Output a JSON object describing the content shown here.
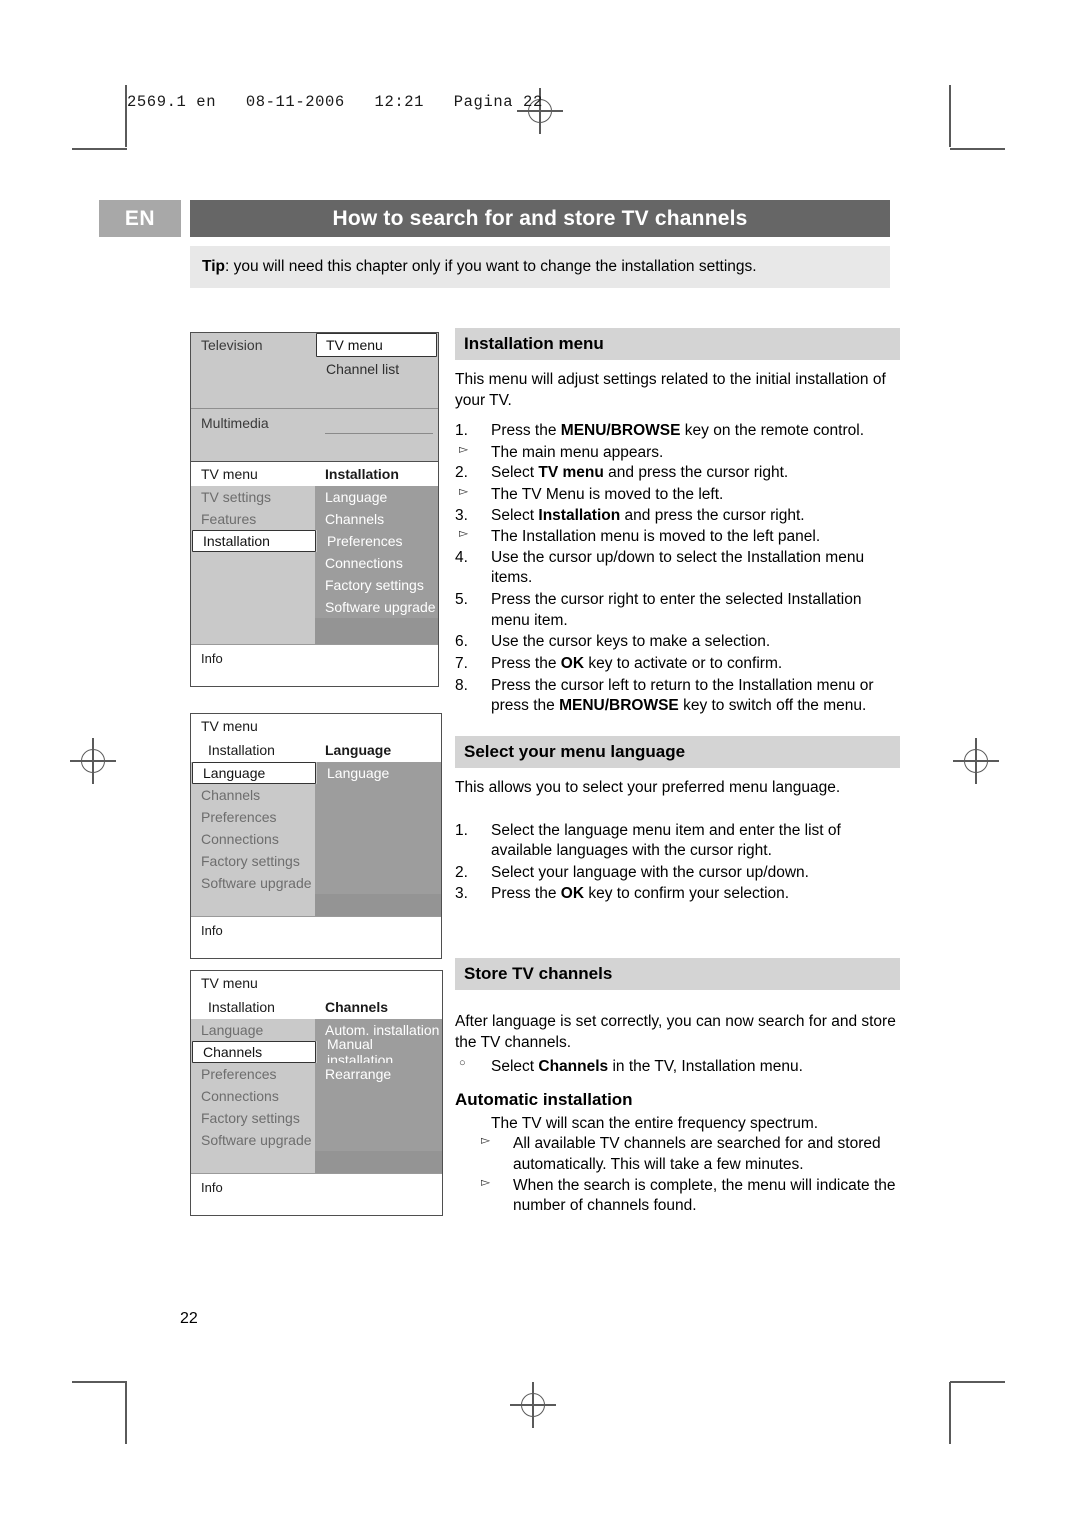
{
  "slug": "2569.1 en   08-11-2006   12:21   Pagina 22",
  "header": {
    "language_tab": "EN",
    "title": "How to search for and store TV channels",
    "tip_label": "Tip",
    "tip_text": ": you will need this chapter only if you want to change the installation settings."
  },
  "page_number": "22",
  "sections": [
    {
      "heading": "Installation menu",
      "intro": "This menu will adjust settings related to the initial installation of your TV.",
      "steps": [
        {
          "num": "1.",
          "text_pre": "Press the ",
          "kw": "MENU/BROWSE",
          "text_post": " key on the remote control.",
          "sub": "The main menu appears."
        },
        {
          "num": "2.",
          "text_pre": "Select ",
          "kw": "TV menu",
          "text_post": " and press the cursor right.",
          "sub": "The TV Menu is moved to the left."
        },
        {
          "num": "3.",
          "text_pre": "Select ",
          "kw": "Installation",
          "text_post": " and press the cursor right.",
          "sub": "The Installation menu is moved to the left panel."
        },
        {
          "num": "4.",
          "text_pre": "Use the cursor up/down to select the Installation menu items.",
          "kw": "",
          "text_post": "",
          "sub": ""
        },
        {
          "num": "5.",
          "text_pre": "Press the cursor right to enter the selected Installation menu item.",
          "kw": "",
          "text_post": "",
          "sub": ""
        },
        {
          "num": "6.",
          "text_pre": "Use the cursor keys to make a selection.",
          "kw": "",
          "text_post": "",
          "sub": ""
        },
        {
          "num": "7.",
          "text_pre": "Press the ",
          "kw": "OK",
          "text_post": " key to activate or to confirm.",
          "sub": ""
        },
        {
          "num": "8.",
          "text_pre": "Press the cursor left to return to the Installation menu or press the ",
          "kw": "MENU/BROWSE",
          "text_post": " key to switch off the menu.",
          "sub": ""
        }
      ]
    },
    {
      "heading": "Select your menu language",
      "intro": "This allows you to select your preferred menu language.",
      "steps": [
        {
          "num": "1.",
          "text_pre": "Select the language menu item and enter the list of available languages with the cursor right.",
          "kw": "",
          "text_post": "",
          "sub": ""
        },
        {
          "num": "2.",
          "text_pre": "Select your language with the cursor up/down.",
          "kw": "",
          "text_post": "",
          "sub": ""
        },
        {
          "num": "3.",
          "text_pre": "Press the ",
          "kw": "OK",
          "text_post": " key to confirm your selection.",
          "sub": ""
        }
      ]
    },
    {
      "heading": "Store TV channels",
      "intro": "After language is set correctly, you can now search for and store the TV channels.",
      "bullet_pre": "Select ",
      "bullet_kw": "Channels",
      "bullet_post": " in the TV, Installation menu.",
      "subheading": "Automatic installation",
      "sub_intro": "The TV will scan the entire frequency spectrum.",
      "sub_bullets": [
        "All available TV channels are searched for and stored automatically. This will take a few minutes.",
        "When the search is complete, the menu will indicate the number of channels found."
      ]
    }
  ],
  "tv_menus": [
    {
      "id": "main-menu",
      "header_left": "Television",
      "header_right": "TV menu",
      "header_right_selected": true,
      "second_right": "Channel list",
      "bottom_left": "Multimedia"
    },
    {
      "id": "installation-menu",
      "header_left": "TV menu",
      "header_right": "Installation",
      "left_items": [
        "TV settings",
        "Features",
        "Installation"
      ],
      "left_selected": "Installation",
      "right_items": [
        "Language",
        "Channels",
        "Preferences",
        "Connections",
        "Factory settings",
        "Software upgrade"
      ],
      "info": "Info"
    },
    {
      "id": "language-menu",
      "header_top": "TV menu",
      "header_left": "Installation",
      "header_right": "Language",
      "left_items": [
        "Language",
        "Channels",
        "Preferences",
        "Connections",
        "Factory settings",
        "Software upgrade"
      ],
      "left_selected": "Language",
      "right_items": [
        "Language"
      ],
      "info": "Info"
    },
    {
      "id": "channels-menu",
      "header_top": "TV menu",
      "header_left": "Installation",
      "header_right": "Channels",
      "left_items": [
        "Language",
        "Channels",
        "Preferences",
        "Connections",
        "Factory settings",
        "Software upgrade"
      ],
      "left_selected": "Channels",
      "right_items": [
        "Autom. installation",
        "Manual installation",
        "Rearrange"
      ],
      "info": "Info"
    }
  ]
}
